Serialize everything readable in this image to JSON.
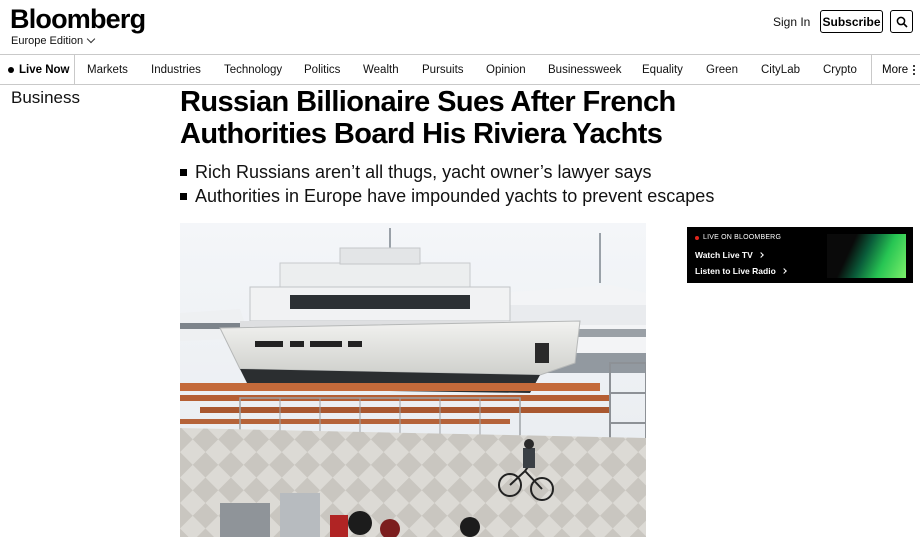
{
  "header": {
    "logo": "Bloomberg",
    "edition": "Europe Edition",
    "sign_in": "Sign In",
    "subscribe": "Subscribe"
  },
  "nav": {
    "live": "Live Now",
    "items": [
      "Markets",
      "Industries",
      "Technology",
      "Politics",
      "Wealth",
      "Pursuits",
      "Opinion",
      "Businessweek",
      "Equality",
      "Green",
      "CityLab",
      "Crypto"
    ],
    "more": "More"
  },
  "section_label": "Business",
  "article": {
    "headline": "Russian Billionaire Sues After French Authorities Board His Riviera Yachts",
    "bullets": [
      "Rich Russians aren’t all thugs, yacht owner’s lawyer says",
      "Authorities in Europe have impounded yachts to prevent escapes"
    ]
  },
  "live_widget": {
    "tag": "LIVE ON BLOOMBERG",
    "watch": "Watch Live TV",
    "listen": "Listen to Live Radio"
  },
  "colors": {
    "live_dot": "#e0261c",
    "thumb_green": "#27c553",
    "rule": "#c9c9c9"
  }
}
